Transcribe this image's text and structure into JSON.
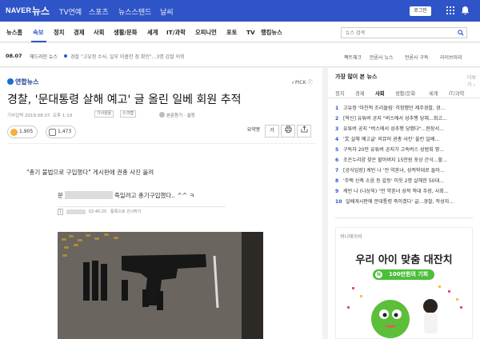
{
  "topbar": {
    "logo": "NAVER",
    "service": "뉴스",
    "links": [
      "TV연예",
      "스포츠",
      "뉴스스탠드",
      "날씨"
    ],
    "login": "로그인"
  },
  "nav": {
    "items": [
      "뉴스홈",
      "속보",
      "정치",
      "경제",
      "사회",
      "생활/문화",
      "세계",
      "IT/과학",
      "오피니언",
      "포토",
      "TV",
      "랭킹뉴스"
    ],
    "active": "속보",
    "search_placeholder": "뉴스 검색"
  },
  "subbar": {
    "date": "08.07",
    "label": "헤드라인 뉴스",
    "headline": "경찰 \"고유정 수사, 일부 미흡한 점 확인\"...3명 감찰 의뢰",
    "links": [
      "팩트체크",
      "언론사 뉴스",
      "언론사 구독",
      "라이브러리"
    ]
  },
  "article": {
    "press": "연합뉴스",
    "pick": "PICK",
    "headline": "경찰, '문대통령 살해 예고' 글 올린 일베 회원 추적",
    "meta": "기사입력 2019.08.07. 오후 1:19",
    "btn_original": "기사원문",
    "btn_scrap": "스크랩",
    "author": "본문듣기 · 설정",
    "tools": [
      "요약봇",
      "가",
      "",
      ""
    ],
    "reactions": [
      "1,905",
      "1,473"
    ],
    "body": "\"총기 불법으로 구입했다\" 게시판에 권총 사진 올려",
    "embed_before": "문",
    "embed_after": "죽일려고 총기구입했다.. ^^ ㅋ",
    "embed_num": "1",
    "embed_time": "02:40:20",
    "embed_report": "통록으로 건너뛰기"
  },
  "sidebar": {
    "title": "가장 많이 본 뉴스",
    "more": "더보기",
    "tabs": [
      "정치",
      "경제",
      "사회",
      "생활/문화",
      "세계",
      "IT/과학"
    ],
    "active_tab": "사회",
    "ranks": [
      "고유정 '아찬적 조리돌림' 걱정했던 제주경찰, 경...",
      "[학신] 유튜버 공지 \"버스에서 성추행 당해...최고...",
      "유튜버 공지 \"버스에서 성추행 당했다\"...현장서...",
      "'文 살해 예고글' 의뮤어 권총 사진' 올린 일베...",
      "구독자 20만 유튜버 공지가 고속버스 성범죄 영...",
      "조은누리양 찾은 할아버지 15만원 포상 간식...할...",
      "[공식입장] 케빈 나 '전 약혼녀, 성적학대로 들아...",
      "'주택 신축 소음 등 갈등' 이웃 2명 살해한 50대...",
      "케빈 나 (나상욱) \"전 약혼녀 성적 학대 주장, 사회...",
      "일베게시판에 문대통령 죽이겠다' 글...경찰, 작성자..."
    ]
  },
  "ad": {
    "brand": "퀴니에이비",
    "headline": "우리 아이 맞춤 대잔치",
    "badge_icon": "N",
    "badge": "100만원의 기회"
  },
  "colors": {
    "brand": "#2e54c7",
    "ad_green": "#4bbf3a"
  }
}
